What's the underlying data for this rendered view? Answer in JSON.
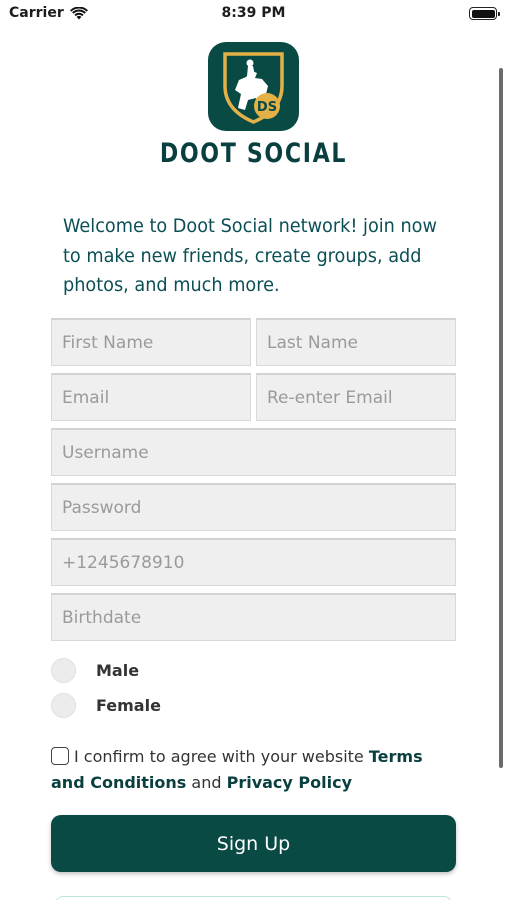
{
  "status_bar": {
    "carrier": "Carrier",
    "time": "8:39 PM"
  },
  "brand": {
    "name": "DOOT SOCIAL",
    "logo_initials": "DS"
  },
  "welcome_text": [
    "Welcome to Doot Social network! join now",
    "to make new friends, create groups, add",
    "photos, and much more."
  ],
  "form": {
    "first_name_placeholder": "First Name",
    "last_name_placeholder": "Last Name",
    "email_placeholder": "Email",
    "reenter_email_placeholder": "Re-enter Email",
    "username_placeholder": "Username",
    "password_placeholder": "Password",
    "phone_placeholder": "+1245678910",
    "birthdate_placeholder": "Birthdate"
  },
  "gender": {
    "male": "Male",
    "female": "Female"
  },
  "terms": {
    "prefix": "I confirm to agree with your website ",
    "terms_link": "Terms and Conditions",
    "joiner": " and ",
    "privacy_link": "Privacy Policy"
  },
  "signup_label": "Sign Up",
  "colors": {
    "brand": "#0a4a45",
    "text_accent": "#0b4f55",
    "gold": "#e3b146"
  },
  "icons": [
    "wifi-icon",
    "battery-icon",
    "horse-rider-logo-icon",
    "shield-icon"
  ]
}
